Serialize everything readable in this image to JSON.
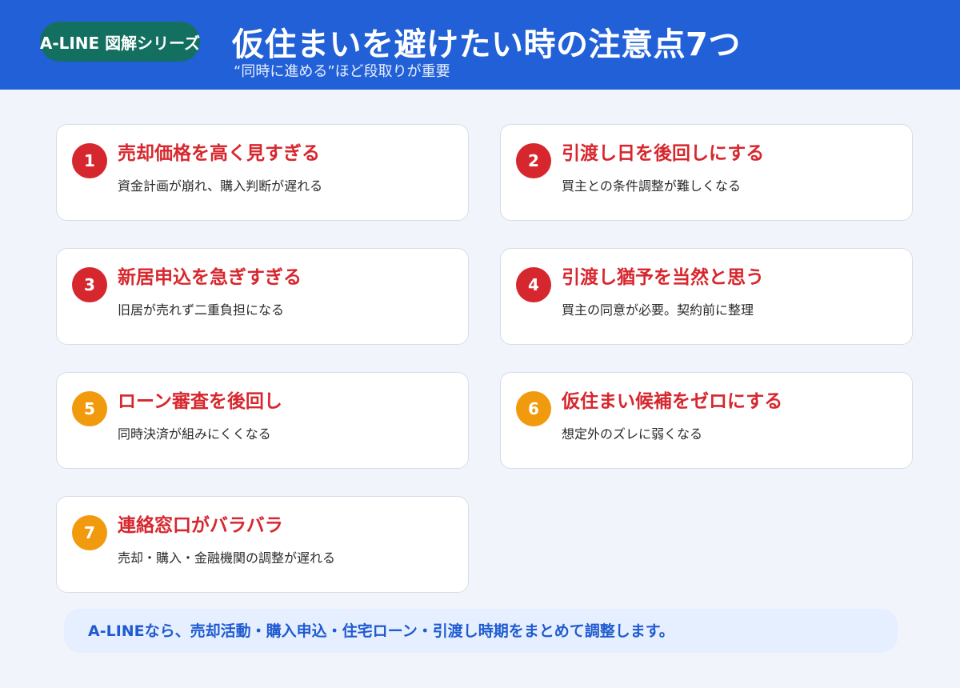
{
  "header": {
    "series_label": "A-LINE 図解シリーズ",
    "title": "仮住まいを避けたい時の注意点7つ",
    "subtitle": "“同時に進める”ほど段取りが重要",
    "background_color": "#2160d6",
    "pill_color": "#137060"
  },
  "cards": [
    {
      "number": "1",
      "title": "売却価格を高く見すぎる",
      "description": "資金計画が崩れ、購入判断が遅れる",
      "badge_color": "#d7272e"
    },
    {
      "number": "2",
      "title": "引渡し日を後回しにする",
      "description": "買主との条件調整が難しくなる",
      "badge_color": "#d7272e"
    },
    {
      "number": "3",
      "title": "新居申込を急ぎすぎる",
      "description": "旧居が売れず二重負担になる",
      "badge_color": "#d7272e"
    },
    {
      "number": "4",
      "title": "引渡し猶予を当然と思う",
      "description": "買主の同意が必要。契約前に整理",
      "badge_color": "#d7272e"
    },
    {
      "number": "5",
      "title": "ローン審査を後回し",
      "description": "同時決済が組みにくくなる",
      "badge_color": "#f29a0e"
    },
    {
      "number": "6",
      "title": "仮住まい候補をゼロにする",
      "description": "想定外のズレに弱くなる",
      "badge_color": "#f29a0e"
    },
    {
      "number": "7",
      "title": "連絡窓口がバラバラ",
      "description": "売却・購入・金融機関の調整が遅れる",
      "badge_color": "#f29a0e"
    }
  ],
  "footer": {
    "text": "A-LINEなら、売却活動・購入申込・住宅ローン・引渡し時期をまとめて調整します。"
  }
}
